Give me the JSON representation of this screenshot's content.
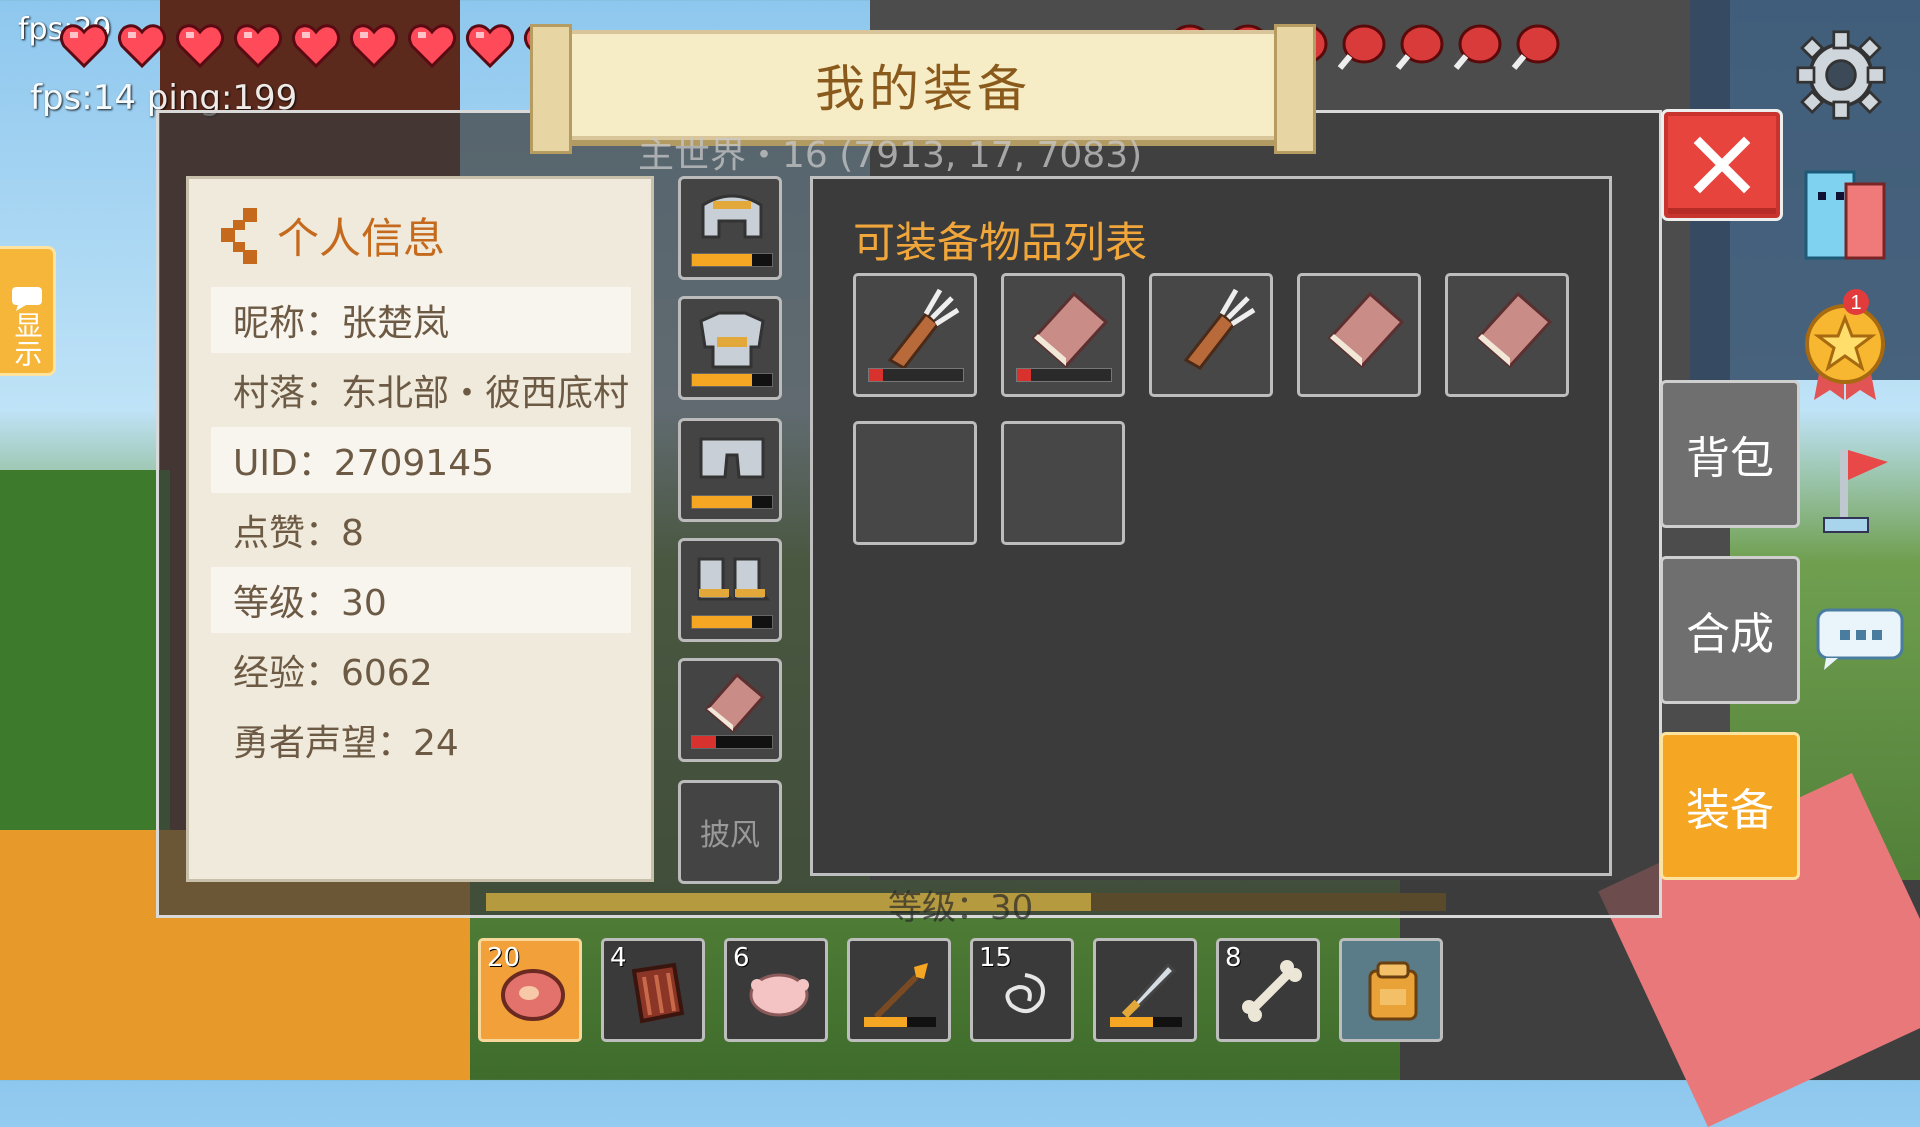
{
  "hud": {
    "fps_top": "fps:29",
    "fps_ping": "fps:14 ping:199",
    "hearts_count": 9,
    "hunger_count": 7,
    "badge_count": "1"
  },
  "title": "我的装备",
  "world_coord": "主世界・16  (7913, 17, 7083)",
  "info": {
    "header": "个人信息",
    "rows": [
      "昵称：张楚岚",
      "村落：东北部・彼西底村",
      " UID：2709145",
      "点赞：8",
      "等级：30",
      "经验：6062",
      "勇者声望：24"
    ]
  },
  "equip_slots": [
    {
      "icon": "helmet-icon",
      "durability": 0.75
    },
    {
      "icon": "chestplate-icon",
      "durability": 0.75
    },
    {
      "icon": "leggings-icon",
      "durability": 0.75
    },
    {
      "icon": "boots-icon",
      "durability": 0.75
    },
    {
      "icon": "book-icon",
      "durability": 0.3
    },
    {
      "icon": "cape-slot",
      "label": "披风"
    }
  ],
  "items": {
    "title": "可装备物品列表",
    "slots": [
      {
        "icon": "quiver-icon",
        "durability": 0.15
      },
      {
        "icon": "book-icon",
        "durability": 0.15
      },
      {
        "icon": "quiver-icon",
        "durability": null
      },
      {
        "icon": "book-icon",
        "durability": null
      },
      {
        "icon": "book-icon",
        "durability": null
      },
      {
        "icon": "empty"
      },
      {
        "icon": "empty"
      }
    ]
  },
  "level_text": "等级：30",
  "level_progress": 0.63,
  "side_tabs": [
    "背包",
    "合成",
    "装备"
  ],
  "show_tab": "显示",
  "hotbar": [
    {
      "icon": "steak-icon",
      "count": "20",
      "selected": true
    },
    {
      "icon": "ribs-icon",
      "count": "4"
    },
    {
      "icon": "chicken-icon",
      "count": "6"
    },
    {
      "icon": "torch-wand-icon",
      "count": "",
      "durability": 0.6
    },
    {
      "icon": "string-icon",
      "count": "15"
    },
    {
      "icon": "sword-icon",
      "count": "",
      "durability": 0.6
    },
    {
      "icon": "bone-icon",
      "count": "8"
    },
    {
      "icon": "backpack-icon",
      "count": ""
    }
  ],
  "colors": {
    "accent_orange": "#f5a623",
    "close_red": "#e8443e",
    "title_brown": "#8a5a1c"
  }
}
